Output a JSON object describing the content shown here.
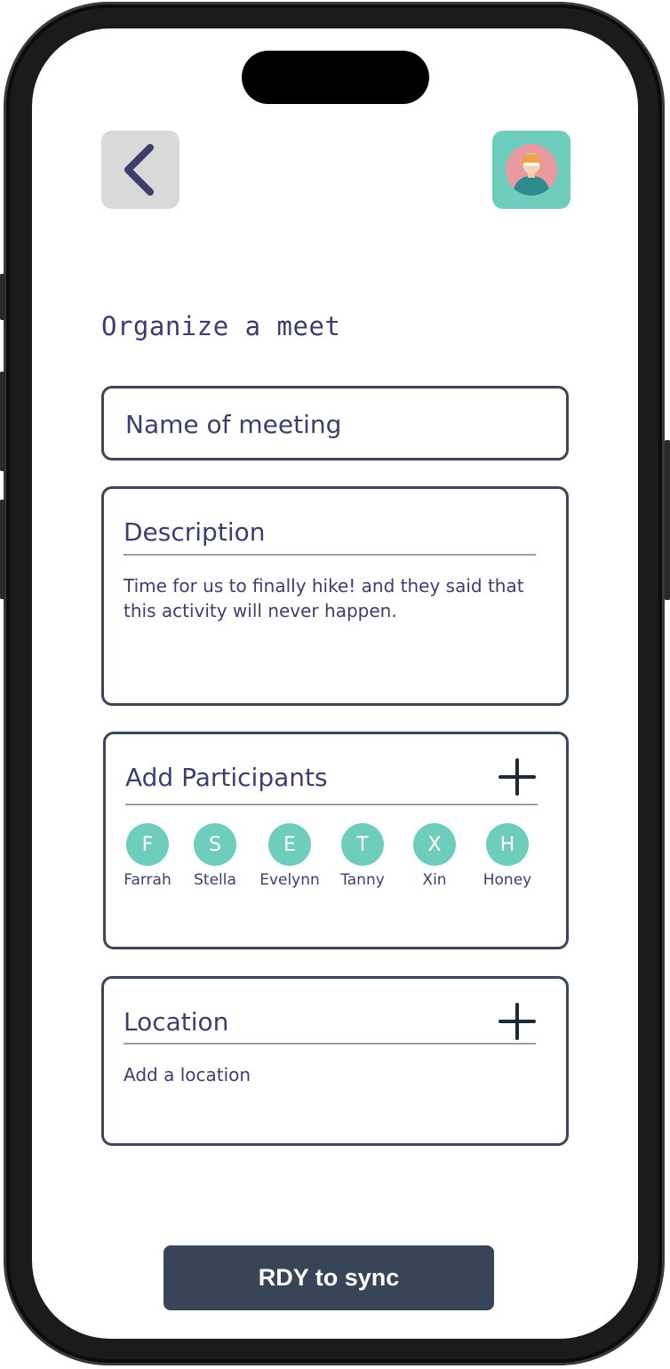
{
  "header": {
    "back_icon": "chevron-left-icon",
    "avatar_icon": "user-avatar-icon"
  },
  "page": {
    "title": "Organize a meet"
  },
  "meeting_name": {
    "placeholder": "Name of meeting",
    "value": ""
  },
  "description": {
    "heading": "Description",
    "text": "Time for us to finally hike! and they said that this activity will never happen."
  },
  "participants": {
    "heading": "Add Participants",
    "add_icon": "plus-icon",
    "items": [
      {
        "initial": "F",
        "name": "Farrah"
      },
      {
        "initial": "S",
        "name": "Stella"
      },
      {
        "initial": "E",
        "name": "Evelynn"
      },
      {
        "initial": "T",
        "name": "Tanny"
      },
      {
        "initial": "X",
        "name": "Xin"
      },
      {
        "initial": "H",
        "name": "Honey"
      }
    ]
  },
  "location": {
    "heading": "Location",
    "add_icon": "plus-icon",
    "placeholder": "Add a location"
  },
  "footer": {
    "sync_label": "RDY to sync"
  },
  "colors": {
    "accent": "#6fcdbd",
    "text": "#3c3f6e",
    "button": "#384457",
    "border": "#3b4657"
  }
}
